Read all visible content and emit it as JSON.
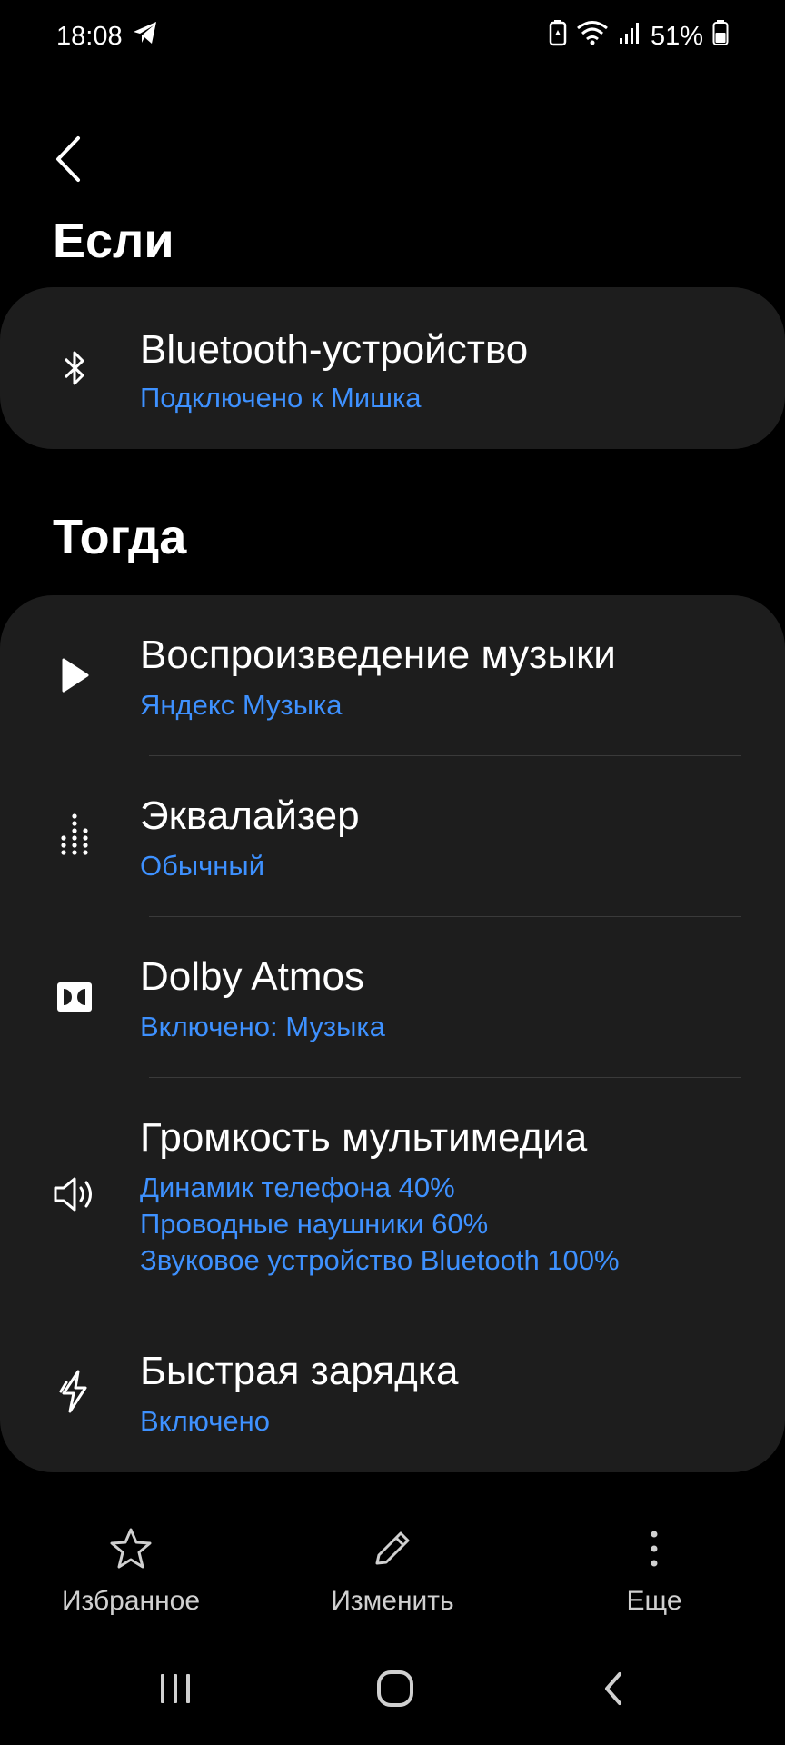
{
  "status_bar": {
    "time": "18:08",
    "battery": "51%",
    "icons": [
      "telegram-icon",
      "battery-saver-icon",
      "wifi-icon",
      "signal-icon",
      "battery-icon"
    ]
  },
  "header": {
    "back_icon": "chevron-left-icon"
  },
  "if_section": {
    "label": "Если",
    "items": [
      {
        "icon": "bluetooth-icon",
        "title": "Bluetooth-устройство",
        "subtitle": "Подключено к Мишка"
      }
    ]
  },
  "then_section": {
    "label": "Тогда",
    "items": [
      {
        "icon": "play-icon",
        "title": "Воспроизведение музыки",
        "subtitle": "Яндекс Музыка"
      },
      {
        "icon": "equalizer-icon",
        "title": "Эквалайзер",
        "subtitle": "Обычный"
      },
      {
        "icon": "dolby-icon",
        "title": "Dolby Atmos",
        "subtitle": "Включено: Музыка"
      },
      {
        "icon": "volume-icon",
        "title": "Громкость мультимедиа",
        "subtitle_lines": [
          "Динамик телефона 40%",
          "Проводные наушники 60%",
          "Звуковое устройство Bluetooth 100%"
        ]
      },
      {
        "icon": "flash-icon",
        "title": "Быстрая зарядка",
        "subtitle": "Включено"
      }
    ]
  },
  "bottom_bar": {
    "favorite_label": "Избранное",
    "edit_label": "Изменить",
    "more_label": "Еще"
  },
  "colors": {
    "accent": "#3e91ff",
    "card": "#1d1d1d",
    "background": "#000000"
  }
}
